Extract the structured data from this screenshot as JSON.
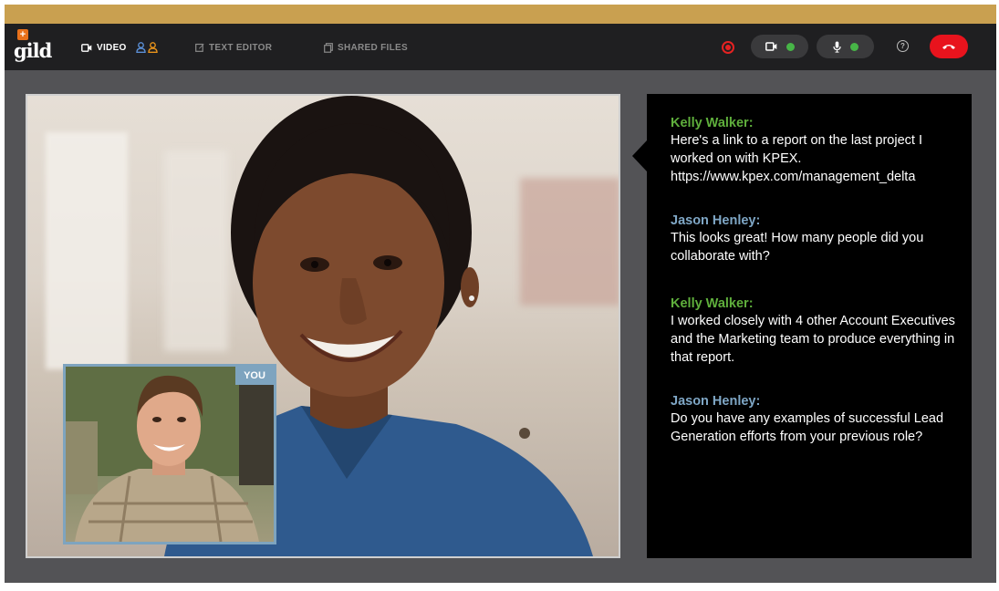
{
  "app": {
    "logo_text": "gild",
    "logo_badge": "+"
  },
  "tabs": [
    {
      "label": "VIDEO",
      "icon": "video-camera-icon",
      "active": true
    },
    {
      "label": "TEXT EDITOR",
      "icon": "edit-icon",
      "active": false
    },
    {
      "label": "SHARED FILES",
      "icon": "files-icon",
      "active": false
    }
  ],
  "participants_icons": [
    "user-icon-blue",
    "user-icon-orange"
  ],
  "controls": {
    "record": "record-icon",
    "camera": "camera-icon",
    "mic": "microphone-icon",
    "help": "?",
    "hangup": "phone-hangup-icon"
  },
  "video": {
    "self_label": "YOU"
  },
  "chat": {
    "messages": [
      {
        "name": "Kelly Walker:",
        "text": "Here's a link to a report on the last project I worked on with KPEX. https://www.kpex.com/management_delta",
        "color": "#5faf3c"
      },
      {
        "name": "Jason Henley:",
        "text": "This looks great! How many people did you collaborate with?",
        "color": "#7fa7c6"
      },
      {
        "name": "Kelly Walker:",
        "text": "I worked closely with 4 other Account Executives and the Marketing team to produce everything in that report.",
        "color": "#5faf3c"
      },
      {
        "name": "Jason Henley:",
        "text": "Do you have any examples of successful Lead Generation efforts from your previous role?",
        "color": "#7fa7c6"
      }
    ]
  },
  "colors": {
    "accent": "#c9a050",
    "topbar": "#1f1f21",
    "stage": "#535356",
    "hangup": "#e8131d",
    "status_ok": "#47b547"
  }
}
